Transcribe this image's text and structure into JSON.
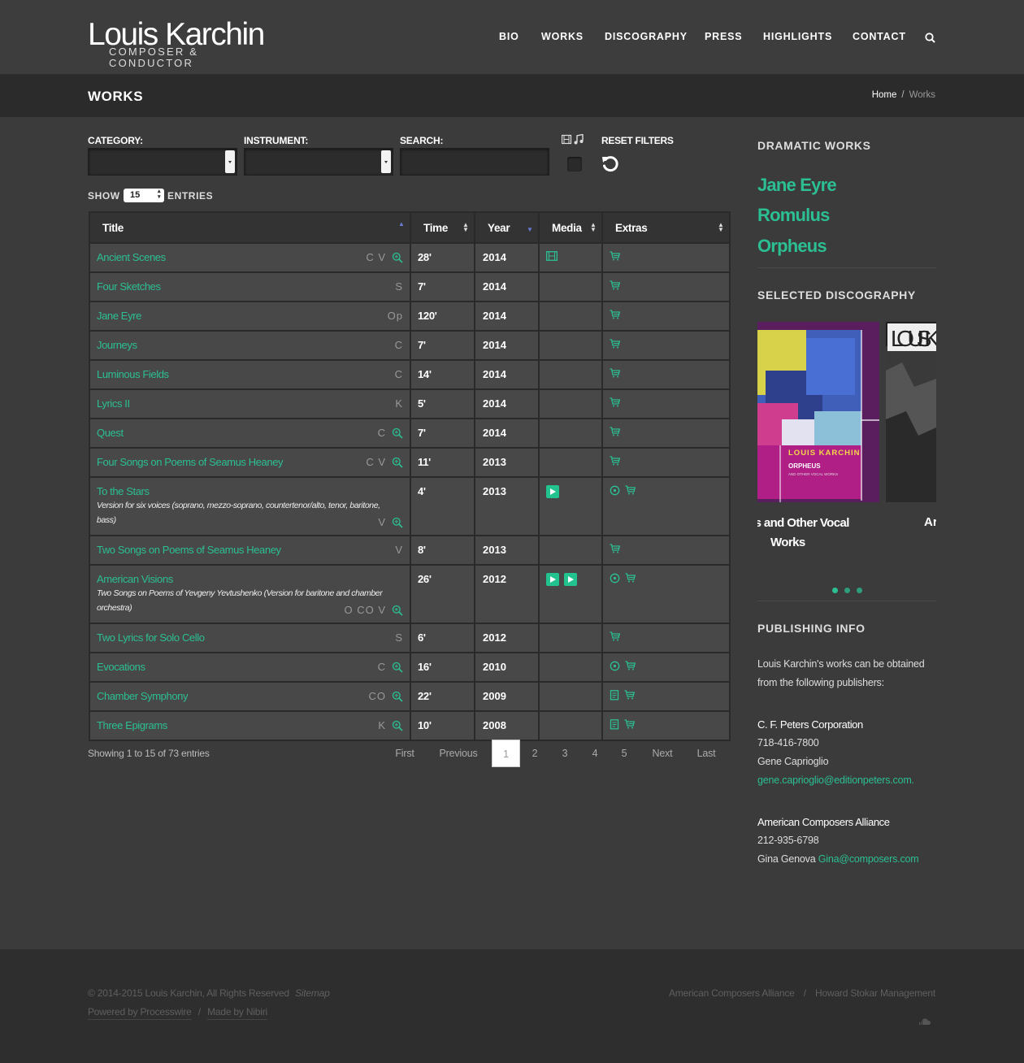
{
  "header": {
    "logo_name": "Louis Karchin",
    "logo_sub": "COMPOSER & CONDUCTOR",
    "nav": [
      "BIO",
      "WORKS",
      "DISCOGRAPHY",
      "PRESS",
      "HIGHLIGHTS",
      "CONTACT"
    ]
  },
  "titlebar": {
    "title": "WORKS",
    "breadcrumb_home": "Home",
    "breadcrumb_sep": "/",
    "breadcrumb_current": "Works"
  },
  "filters": {
    "category_label": "CATEGORY:",
    "instrument_label": "INSTRUMENT:",
    "search_label": "SEARCH:",
    "reset_label": "RESET FILTERS",
    "show_label": "SHOW",
    "show_value": "15",
    "entries_label": "ENTRIES"
  },
  "table": {
    "headers": [
      "Title",
      "Time",
      "Year",
      "Media",
      "Extras"
    ],
    "rows": [
      {
        "title": "Ancient Scenes",
        "sub": "",
        "codes": "C V",
        "zoom": true,
        "time": "28'",
        "year": "2014",
        "media": [
          "film"
        ],
        "extras": [
          "cart"
        ]
      },
      {
        "title": "Four Sketches",
        "sub": "",
        "codes": "S",
        "zoom": false,
        "time": "7'",
        "year": "2014",
        "media": [],
        "extras": [
          "cart"
        ]
      },
      {
        "title": "Jane Eyre",
        "sub": "",
        "codes": "Op",
        "zoom": false,
        "time": "120'",
        "year": "2014",
        "media": [],
        "extras": [
          "cart"
        ]
      },
      {
        "title": "Journeys",
        "sub": "",
        "codes": "C",
        "zoom": false,
        "time": "7'",
        "year": "2014",
        "media": [],
        "extras": [
          "cart"
        ]
      },
      {
        "title": "Luminous Fields",
        "sub": "",
        "codes": "C",
        "zoom": false,
        "time": "14'",
        "year": "2014",
        "media": [],
        "extras": [
          "cart"
        ]
      },
      {
        "title": "Lyrics II",
        "sub": "",
        "codes": "K",
        "zoom": false,
        "time": "5'",
        "year": "2014",
        "media": [],
        "extras": [
          "cart"
        ]
      },
      {
        "title": "Quest",
        "sub": "",
        "codes": "C",
        "zoom": true,
        "time": "7'",
        "year": "2014",
        "media": [],
        "extras": [
          "cart"
        ]
      },
      {
        "title": "Four Songs on Poems of Seamus Heaney",
        "sub": "",
        "codes": "C V",
        "zoom": true,
        "time": "11'",
        "year": "2013",
        "media": [],
        "extras": [
          "cart"
        ]
      },
      {
        "title": "To the Stars",
        "sub": "Version for six voices (soprano, mezzo-soprano, countertenor/alto, tenor, baritone, bass)",
        "codes": "V",
        "zoom": true,
        "time": "4'",
        "year": "2013",
        "media": [
          "play"
        ],
        "extras": [
          "disc",
          "cart"
        ]
      },
      {
        "title": "Two Songs on Poems of Seamus Heaney",
        "sub": "",
        "codes": "V",
        "zoom": false,
        "time": "8'",
        "year": "2013",
        "media": [],
        "extras": [
          "cart"
        ]
      },
      {
        "title": "American Visions",
        "sub": "Two Songs on Poems of Yevgeny Yevtushenko (Version for baritone and chamber orchestra)",
        "codes": "O CO V",
        "zoom": true,
        "time": "26'",
        "year": "2012",
        "media": [
          "play",
          "play"
        ],
        "extras": [
          "disc",
          "cart"
        ]
      },
      {
        "title": "Two Lyrics for Solo Cello",
        "sub": "",
        "codes": "S",
        "zoom": false,
        "time": "6'",
        "year": "2012",
        "media": [],
        "extras": [
          "cart"
        ]
      },
      {
        "title": "Evocations",
        "sub": "",
        "codes": "C",
        "zoom": true,
        "time": "16'",
        "year": "2010",
        "media": [],
        "extras": [
          "disc",
          "cart"
        ]
      },
      {
        "title": "Chamber Symphony",
        "sub": "",
        "codes": "CO",
        "zoom": true,
        "time": "22'",
        "year": "2009",
        "media": [],
        "extras": [
          "book",
          "cart"
        ]
      },
      {
        "title": "Three Epigrams",
        "sub": "",
        "codes": "K",
        "zoom": true,
        "time": "10'",
        "year": "2008",
        "media": [],
        "extras": [
          "book",
          "cart"
        ]
      }
    ],
    "info": "Showing 1 to 15 of 73 entries",
    "pager": [
      "First",
      "Previous",
      "1",
      "2",
      "3",
      "4",
      "5",
      "Next",
      "Last"
    ],
    "current_page": "1"
  },
  "sidebar": {
    "dramatic_head": "DRAMATIC WORKS",
    "dramatic_works": [
      "Jane Eyre",
      "Romulus",
      "Orpheus"
    ],
    "discography_head": "SELECTED DISCOGRAPHY",
    "album1_cover_artist": "LOUIS KARCHIN",
    "album1_cover_title": "ORPHEUS",
    "album1_cover_sub": "AND OTHER VOCAL WORKS",
    "album1_caption_1": "is and Other Vocal",
    "album1_caption_2": "Works",
    "album2_cover_text": "LOUIS K",
    "album2_caption": "Ar",
    "publishing_head": "PUBLISHING INFO",
    "publishing_text": "Louis Karchin's works can be obtained from the following publishers:",
    "publisher1_name": "C. F. Peters Corporation",
    "publisher1_phone": "718-416-7800",
    "publisher1_contact": "Gene Caprioglio",
    "publisher1_email": "gene.caprioglio@editionpeters.com.",
    "publisher2_name": "American Composers Alliance",
    "publisher2_phone": "212-935-6798",
    "publisher2_contact": "Gina Genova",
    "publisher2_email": "Gina@composers.com"
  },
  "footer": {
    "copyright": "© 2014-2015 Louis Karchin, All Rights Reserved",
    "sitemap": "Sitemap",
    "powered": "Powered by Processwire",
    "made_by": "Made by Nibiri",
    "link1": "American Composers Alliance",
    "link2": "Howard Stokar Management",
    "sep": "/"
  },
  "colors": {
    "accent": "#2bbf93",
    "background": "#3b3b3b",
    "header_bar": "#2b2b2b",
    "row": "#484848"
  }
}
